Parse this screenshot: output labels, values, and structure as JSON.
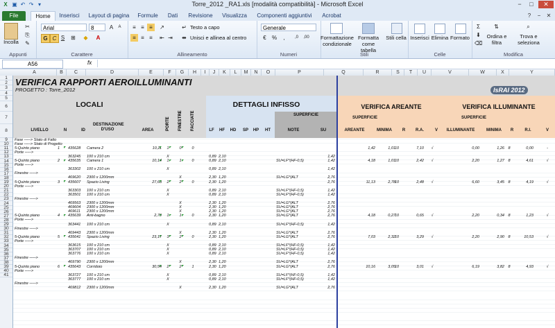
{
  "window": {
    "title": "Torre_2012 _RA1.xls  [modalità compatibilità]  -  Microsoft Excel",
    "controls": [
      "−",
      "□",
      "✕"
    ]
  },
  "tabs": [
    "File",
    "Home",
    "Inserisci",
    "Layout di pagina",
    "Formule",
    "Dati",
    "Revisione",
    "Visualizza",
    "Componenti aggiuntivi",
    "Acrobat"
  ],
  "ribbon": {
    "clipboard": {
      "paste": "Incolla",
      "label": "Appunti"
    },
    "font": {
      "name": "Arial",
      "size": "8",
      "bold": "G",
      "italic": "C",
      "underline": "S",
      "label": "Carattere"
    },
    "alignment": {
      "wrap": "Testo a capo",
      "merge": "Unisci e allinea al centro",
      "label": "Allineamento"
    },
    "number": {
      "format": "Generale",
      "label": "Numeri"
    },
    "styles": {
      "cond": "Formattazione condizionale",
      "table": "Formatta come tabella",
      "cell": "Stili cella",
      "label": "Stili"
    },
    "cells": {
      "insert": "Inserisci",
      "delete": "Elimina",
      "format": "Formato",
      "label": "Celle"
    },
    "editing": {
      "sort": "Ordina e filtra",
      "find": "Trova e seleziona",
      "label": "Modifica"
    }
  },
  "formula_bar": {
    "name_box": "A56",
    "fx": "fx",
    "content": ""
  },
  "columns": [
    "A",
    "B",
    "C",
    "D",
    "E",
    "F",
    "G",
    "H",
    "I",
    "J",
    "K",
    "L",
    "M",
    "N",
    "O",
    "P",
    "Q",
    "R",
    "S",
    "T",
    "U",
    "V",
    "W",
    "X",
    "Y"
  ],
  "rows": [
    1,
    2,
    3,
    4,
    5,
    6,
    7,
    8,
    9,
    10,
    11,
    12,
    13,
    14,
    15,
    16,
    17,
    18,
    19,
    20,
    21,
    22,
    23,
    24,
    25,
    26,
    27,
    28,
    29,
    30,
    31,
    32,
    33,
    34,
    35,
    36,
    37,
    38,
    39,
    40,
    41
  ],
  "sheet": {
    "title": "VERIFICA RAPPORTI AEROILLUMINANTI",
    "project": "PROGETTO : Torre_2012",
    "logo": "IsRAI 2012",
    "headers": {
      "locali": "LOCALI",
      "dettagli": "DETTAGLI INFISSO",
      "areante": "VERIFICA AREANTE",
      "illuminante": "VERIFICA ILLUMINANTE",
      "superficie": "SUPERFICIE",
      "porte": "PORTE",
      "finestre": "FINESTRE",
      "facciate": "FACCIATE",
      "livello": "LIVELLO",
      "n": "N",
      "id": "ID",
      "destinazione": "DESTINAZIONE D'USO",
      "area": "AREA",
      "lf": "LF",
      "hf": "HF",
      "hd": "HD",
      "sp": "SP",
      "hp": "HP",
      "ht": "HT",
      "note": "NOTE",
      "su": "SU",
      "areante_col": "AREANTE",
      "minima": "MINIMA",
      "rr": "R",
      "ra": "R.A.",
      "v": "V",
      "illuminante_col": "ILLUMINANTE",
      "minima2": "MINIMA",
      "r2": "R",
      "ri": "R.I.",
      "v2": "V"
    },
    "rows": [
      {
        "row": 9,
        "A": "Fase -----> Stato di Fatto"
      },
      {
        "row": 10,
        "A": "Fase -----> Stato di Progetto"
      },
      {
        "row": 11,
        "A": "5-Quinto piano",
        "B": "1",
        "C": "435628",
        "D": "Camera 2",
        "E": "10,11",
        "F": "1",
        "G": "0",
        "H": "0",
        "Q": "1,42",
        "Rm": "1,01",
        "R": "10",
        "RA": "7,10",
        "V": "√",
        "U": "0,00",
        "W": "1,26",
        "X": "8",
        "Y": "0,00",
        "Z": "-"
      },
      {
        "row": 12,
        "A": "Porte ----->"
      },
      {
        "row": 13,
        "C": "363245",
        "D": "100 x 210 cm",
        "F": "X",
        "J": "0,89",
        "K": "2,10",
        "P": "1,42"
      },
      {
        "row": 14,
        "A": "5-Quinto piano",
        "B": "2",
        "C": "435635",
        "D": "Camera 1",
        "E": "10,14",
        "F": "1",
        "G": "1",
        "H": "0",
        "J": "0,89",
        "K": "2,10",
        "O": "SU=LF*(HF-0,5)",
        "P": "1,42",
        "Q": "4,18",
        "Rm": "1,01",
        "R": "10",
        "RA": "2,42",
        "V": "√",
        "U": "2,20",
        "W": "1,27",
        "X": "8",
        "Y": "4,61",
        "Z": "√"
      },
      {
        "row": 15,
        "A": "Porte ----->"
      },
      {
        "row": 16,
        "C": "363302",
        "D": "100 x 210 cm",
        "F": "X",
        "J": "0,89",
        "K": "2,10",
        "P": "1,42"
      },
      {
        "row": 17,
        "A": "Finestre ----->"
      },
      {
        "row": 18,
        "C": "469620",
        "D": "2300 x 1200mm",
        "G": "X",
        "J": "2,30",
        "K": "1,20",
        "O": "SU=LG*(ALT",
        "P": "2,76"
      },
      {
        "row": 19,
        "A": "5-Quinto piano",
        "B": "3",
        "C": "435607",
        "D": "Spazio Living",
        "E": "27,63",
        "F": "2",
        "G": "2",
        "H": "0",
        "J": "2,30",
        "K": "1,20",
        "P": "2,76",
        "Q": "11,13",
        "Rm": "2,78",
        "R": "10",
        "RA": "2,48",
        "V": "√",
        "U": "6,60",
        "W": "3,45",
        "X": "8",
        "Y": "4,19",
        "Z": "√"
      },
      {
        "row": 20,
        "A": "Porte ----->"
      },
      {
        "row": 21,
        "C": "363303",
        "D": "100 x 210 cm",
        "F": "X",
        "J": "0,89",
        "K": "2,10",
        "O": "SU=LF*(HF-0,5)",
        "P": "1,42"
      },
      {
        "row": 22,
        "C": "363501",
        "D": "100 x 210 cm",
        "F": "X",
        "J": "0,89",
        "K": "2,10",
        "O": "SU=LF*(HF-0,5)",
        "P": "1,42"
      },
      {
        "row": 23,
        "A": "Finestre ----->"
      },
      {
        "row": 24,
        "C": "469563",
        "D": "2300 x 1200mm",
        "G": "X",
        "J": "2,30",
        "K": "1,20",
        "O": "SU=LG*(ALT",
        "P": "2,76"
      },
      {
        "row": 25,
        "C": "469604",
        "D": "2300 x 1200mm",
        "G": "X",
        "J": "2,30",
        "K": "1,20",
        "O": "SU=LG*(ALT",
        "P": "2,76"
      },
      {
        "row": 26,
        "C": "469611",
        "D": "2300 x 1200mm",
        "G": "X",
        "J": "2,30",
        "K": "1,20",
        "O": "SU=LG*(ALT",
        "P": "2,76"
      },
      {
        "row": 27,
        "A": "5-Quinto piano",
        "B": "4",
        "C": "435639",
        "D": "Anti-bagno",
        "E": "2,70",
        "F": "1",
        "G": "1",
        "H": "0",
        "J": "2,30",
        "K": "1,20",
        "O": "SU=LG*(ALT",
        "P": "2,76",
        "Q": "4,18",
        "Rm": "0,27",
        "R": "10",
        "RA": "0,65",
        "V": "√",
        "U": "2,20",
        "W": "0,34",
        "X": "8",
        "Y": "1,23",
        "Z": "√"
      },
      {
        "row": 28,
        "A": "Porte ----->"
      },
      {
        "row": 29,
        "C": "363441",
        "D": "100 x 210 cm",
        "F": "X",
        "J": "0,89",
        "K": "2,10",
        "O": "SU=LF*(HF-0,5)",
        "P": "1,42"
      },
      {
        "row": 30,
        "A": "Finestre ----->"
      },
      {
        "row": 31,
        "C": "469443",
        "D": "2300 x 1200mm",
        "G": "X",
        "J": "2,30",
        "K": "1,20",
        "O": "SU=LG*(ALT",
        "P": "2,76"
      },
      {
        "row": 32,
        "A": "5-Quinto piano",
        "B": "5",
        "C": "435641",
        "D": "Spazio Living",
        "E": "23,17",
        "F": "3",
        "G": "2",
        "H": "0",
        "J": "2,30",
        "K": "1,20",
        "O": "SU=LG*(ALT",
        "P": "2,76",
        "Q": "7,03",
        "Rm": "2,32",
        "R": "10",
        "RA": "3,29",
        "V": "√",
        "U": "2,20",
        "W": "2,90",
        "X": "8",
        "Y": "10,53",
        "Z": "√"
      },
      {
        "row": 33,
        "A": "Porte ----->"
      },
      {
        "row": 34,
        "C": "363615",
        "D": "100 x 210 cm",
        "F": "X",
        "J": "0,89",
        "K": "2,10",
        "O": "SU=LF*(HF-0,5)",
        "P": "1,42"
      },
      {
        "row": 35,
        "C": "363707",
        "D": "100 x 210 cm",
        "F": "X",
        "J": "0,89",
        "K": "2,10",
        "O": "SU=LF*(HF-0,5)",
        "P": "1,42"
      },
      {
        "row": 36,
        "C": "363776",
        "D": "100 x 210 cm",
        "F": "X",
        "J": "0,89",
        "K": "2,10",
        "O": "SU=LF*(HF-0,5)",
        "P": "1,42"
      },
      {
        "row": 37,
        "A": "Finestre ----->"
      },
      {
        "row": 38,
        "C": "469790",
        "D": "2300 x 1200mm",
        "G": "X",
        "J": "2,30",
        "K": "1,20",
        "O": "SU=LG*(ALT",
        "P": "2,76"
      },
      {
        "row": 39,
        "A": "5-Quinto piano",
        "B": "6",
        "C": "435643",
        "D": "Corridoio",
        "E": "30,54",
        "F": "2",
        "G": "2",
        "H": "1",
        "J": "2,30",
        "K": "1,20",
        "O": "SU=LG*(ALT",
        "P": "2,76",
        "Q": "10,16",
        "Rm": "3,05",
        "R": "10",
        "RA": "3,01",
        "V": "√",
        "U": "6,19",
        "W": "3,82",
        "X": "8",
        "Y": "4,93",
        "Z": "√"
      },
      {
        "row": 40,
        "A": "Porte ----->"
      },
      {
        "row": 41,
        "C": "363727",
        "D": "100 x 210 cm",
        "F": "X",
        "J": "0,89",
        "K": "2,10",
        "O": "SU=LF*(HF-0,5)",
        "P": "1,42"
      },
      {
        "row": 42,
        "C": "363777",
        "D": "100 x 210 cm",
        "F": "X",
        "J": "0,89",
        "K": "2,10",
        "O": "SU=LF*(HF-0,5)",
        "P": "1,42"
      },
      {
        "row": 43,
        "A": "Finestre ----->"
      },
      {
        "row": 44,
        "C": "469812",
        "D": "2300 x 1200mm",
        "G": "X",
        "J": "2,30",
        "K": "1,20",
        "O": "SU=LG*(ALT",
        "P": "2,76"
      }
    ]
  },
  "colors": {
    "accent_blue": "#d7e3f1",
    "accent_orange": "#f8d6b8",
    "file_tab": "#2a7a30",
    "freeze_line": "#2b3f9f",
    "grey_header": "#b3b3b3"
  }
}
